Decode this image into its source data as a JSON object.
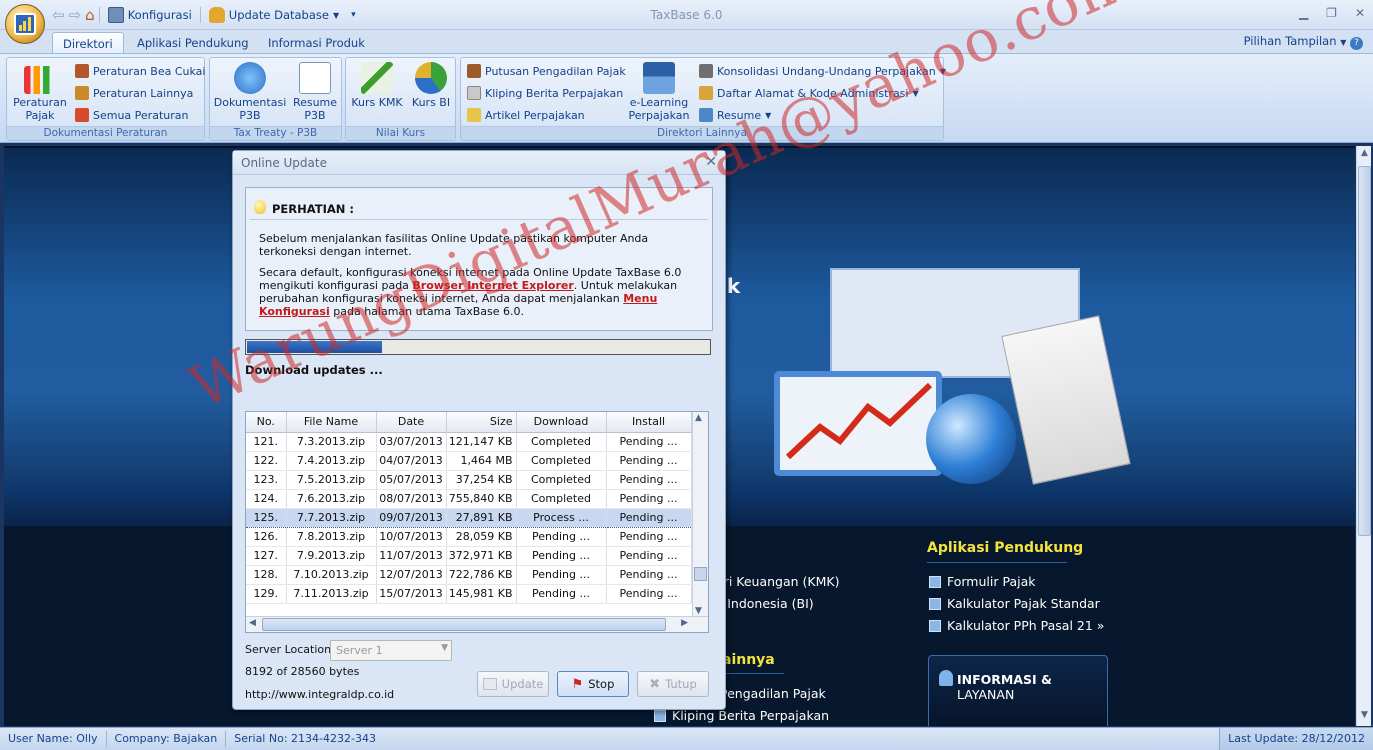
{
  "app": {
    "title": "TaxBase 6.0"
  },
  "quick_access": {
    "konfigurasi": "Konfigurasi",
    "update_database": "Update Database"
  },
  "tabs": [
    {
      "label": "Direktori"
    },
    {
      "label": "Aplikasi Pendukung"
    },
    {
      "label": "Informasi Produk"
    }
  ],
  "pilihan_tampilan": "Pilihan Tampilan",
  "ribbon": {
    "dokumentasi": {
      "label": "Dokumentasi Peraturan",
      "peraturan_pajak": "Peraturan\nPajak",
      "items": [
        "Peraturan Bea Cukai",
        "Peraturan Lainnya",
        "Semua Peraturan"
      ]
    },
    "tax_treaty": {
      "label": "Tax Treaty - P3B",
      "dokumentasi_p3b": "Dokumentasi\nP3B",
      "resume_p3b": "Resume\nP3B"
    },
    "nilai_kurs": {
      "label": "Nilai Kurs",
      "kurs_kmk": "Kurs KMK",
      "kurs_bi": "Kurs BI"
    },
    "direktori_lainnya": {
      "label": "Direktori Lainnya",
      "items": [
        "Putusan Pengadilan Pajak",
        "Kliping Berita Perpajakan",
        "Artikel Perpajakan"
      ],
      "elearning": "e-Learning\nPerpajakan",
      "items2": [
        "Konsolidasi Undang-Undang Perpajakan",
        "Daftar Alamat & Kode Administrasi",
        "Resume"
      ]
    }
  },
  "background": {
    "hero_fragment": "ik",
    "aplikasi_pendukung": {
      "title": "Aplikasi Pendukung",
      "items": [
        "Formulir Pajak",
        "Kalkulator Pajak Standar",
        "Kalkulator PPh Pasal 21 »"
      ]
    },
    "kurs_items": [
      "eri Keuangan (KMK)",
      "k Indonesia (BI)"
    ],
    "lainnya_title": "ainnya",
    "lainnya_items": [
      "Pengadilan Pajak",
      "Kliping Berita Perpajakan"
    ],
    "informasi_layanan_a": "INFORMASI &",
    "informasi_layanan_b": "LAYANAN"
  },
  "watermark": "WarungDigitalMurah@yahoo.com",
  "dialog": {
    "title": "Online Update",
    "notice_title": "PERHATIAN :",
    "p1": "Sebelum menjalankan fasilitas Online Update pastikan komputer Anda terkoneksi dengan internet.",
    "p2_a": "Secara default, konfigurasi koneksi internet pada Online Update TaxBase 6.0 mengikuti konfigurasi pada ",
    "p2_link1": "Browser Internet Explorer",
    "p2_b": ". Untuk melakukan perubahan konfigurasi koneksi internet, Anda dapat menjalankan ",
    "p2_link2": "Menu Konfigurasi",
    "p2_c": " pada halaman utama TaxBase 6.0.",
    "progress": 0.29,
    "status": "Download updates ...",
    "columns": [
      "No.",
      "File Name",
      "Date",
      "Size",
      "Download",
      "Install"
    ],
    "rows": [
      [
        "121.",
        "7.3.2013.zip",
        "03/07/2013",
        "121,147 KB",
        "Completed",
        "Pending ..."
      ],
      [
        "122.",
        "7.4.2013.zip",
        "04/07/2013",
        "1,464 MB",
        "Completed",
        "Pending ..."
      ],
      [
        "123.",
        "7.5.2013.zip",
        "05/07/2013",
        "37,254 KB",
        "Completed",
        "Pending ..."
      ],
      [
        "124.",
        "7.6.2013.zip",
        "08/07/2013",
        "755,840 KB",
        "Completed",
        "Pending ..."
      ],
      [
        "125.",
        "7.7.2013.zip",
        "09/07/2013",
        "27,891 KB",
        "Process ...",
        "Pending ..."
      ],
      [
        "126.",
        "7.8.2013.zip",
        "10/07/2013",
        "28,059 KB",
        "Pending ...",
        "Pending ..."
      ],
      [
        "127.",
        "7.9.2013.zip",
        "11/07/2013",
        "372,971 KB",
        "Pending ...",
        "Pending ..."
      ],
      [
        "128.",
        "7.10.2013.zip",
        "12/07/2013",
        "722,786 KB",
        "Pending ...",
        "Pending ..."
      ],
      [
        "129.",
        "7.11.2013.zip",
        "15/07/2013",
        "145,981 KB",
        "Pending ...",
        "Pending ..."
      ]
    ],
    "selected_row": 4,
    "server_location_label": "Server Location :",
    "server_value": "Server 1",
    "bytes": "8192 of 28560 bytes",
    "url": "http://www.integraldp.co.id",
    "btn_update": "Update",
    "btn_stop": "Stop",
    "btn_tutup": "Tutup"
  },
  "status": {
    "user": "User Name: Olly",
    "company": "Company: Bajakan",
    "serial": "Serial No: 2134-4232-343",
    "last_update": "Last Update: 28/12/2012"
  }
}
